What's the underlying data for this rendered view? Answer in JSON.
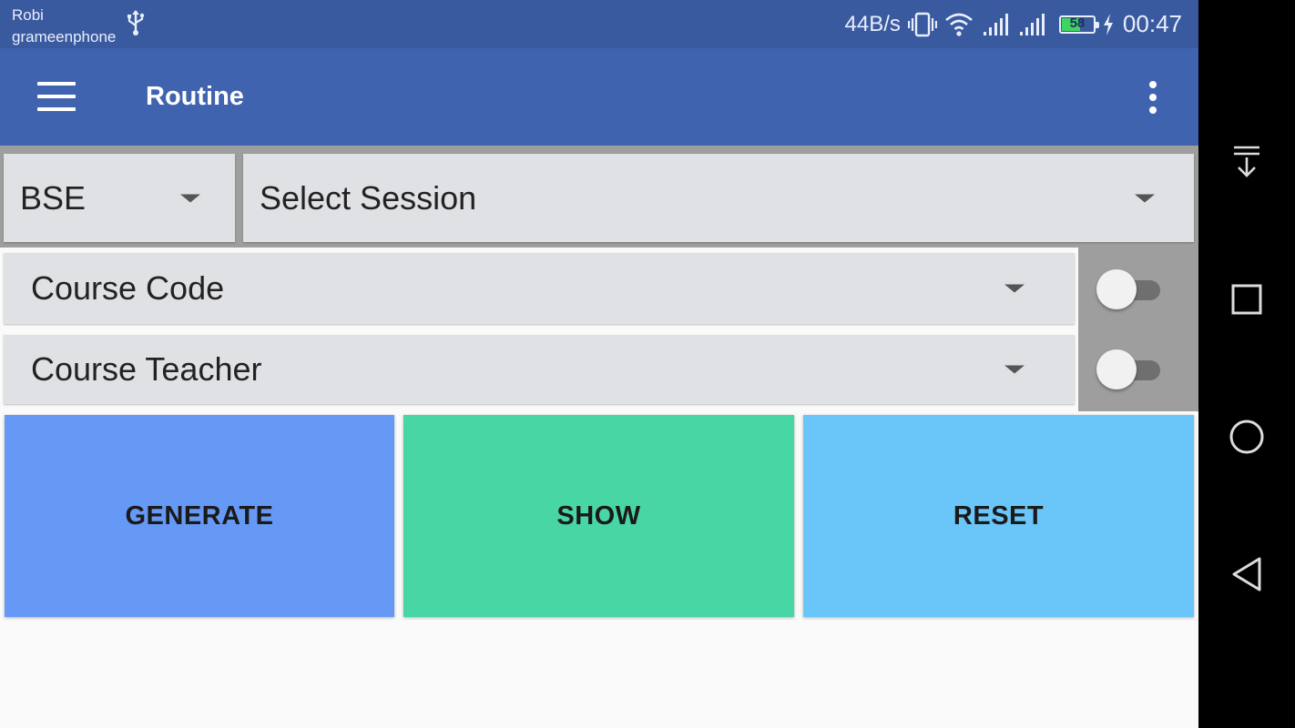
{
  "status_bar": {
    "carrier_1": "Robi",
    "carrier_2": "grameenphone",
    "net_speed": "44B/s",
    "battery_percent": "58",
    "battery_level": 0.58,
    "time": "00:47",
    "icons": [
      "usb-icon",
      "vibrate-icon",
      "wifi-icon",
      "signal-icon",
      "signal-icon",
      "battery-icon",
      "charging-icon"
    ]
  },
  "app_bar": {
    "title": "Routine",
    "menu_icon": "menu-icon",
    "overflow_icon": "more-vert-icon"
  },
  "filters": {
    "department": {
      "value": "BSE"
    },
    "session": {
      "value": "Select Session"
    },
    "course_code": {
      "value": "Course Code",
      "toggle_on": false
    },
    "course_teacher": {
      "value": "Course Teacher",
      "toggle_on": false
    }
  },
  "actions": {
    "generate": {
      "label": "GENERATE",
      "color": "#6699f5"
    },
    "show": {
      "label": "SHOW",
      "color": "#48d6a5"
    },
    "reset": {
      "label": "RESET",
      "color": "#6ac6f9"
    }
  },
  "nav_bar": {
    "icons": [
      "notification-pull-icon",
      "recents-icon",
      "home-icon",
      "back-icon"
    ]
  },
  "colors": {
    "status_bar": "#3a5a9f",
    "app_bar": "#4063b0",
    "dropdown_bg": "#e0e1e4",
    "divider_gray": "#9e9e9e"
  }
}
